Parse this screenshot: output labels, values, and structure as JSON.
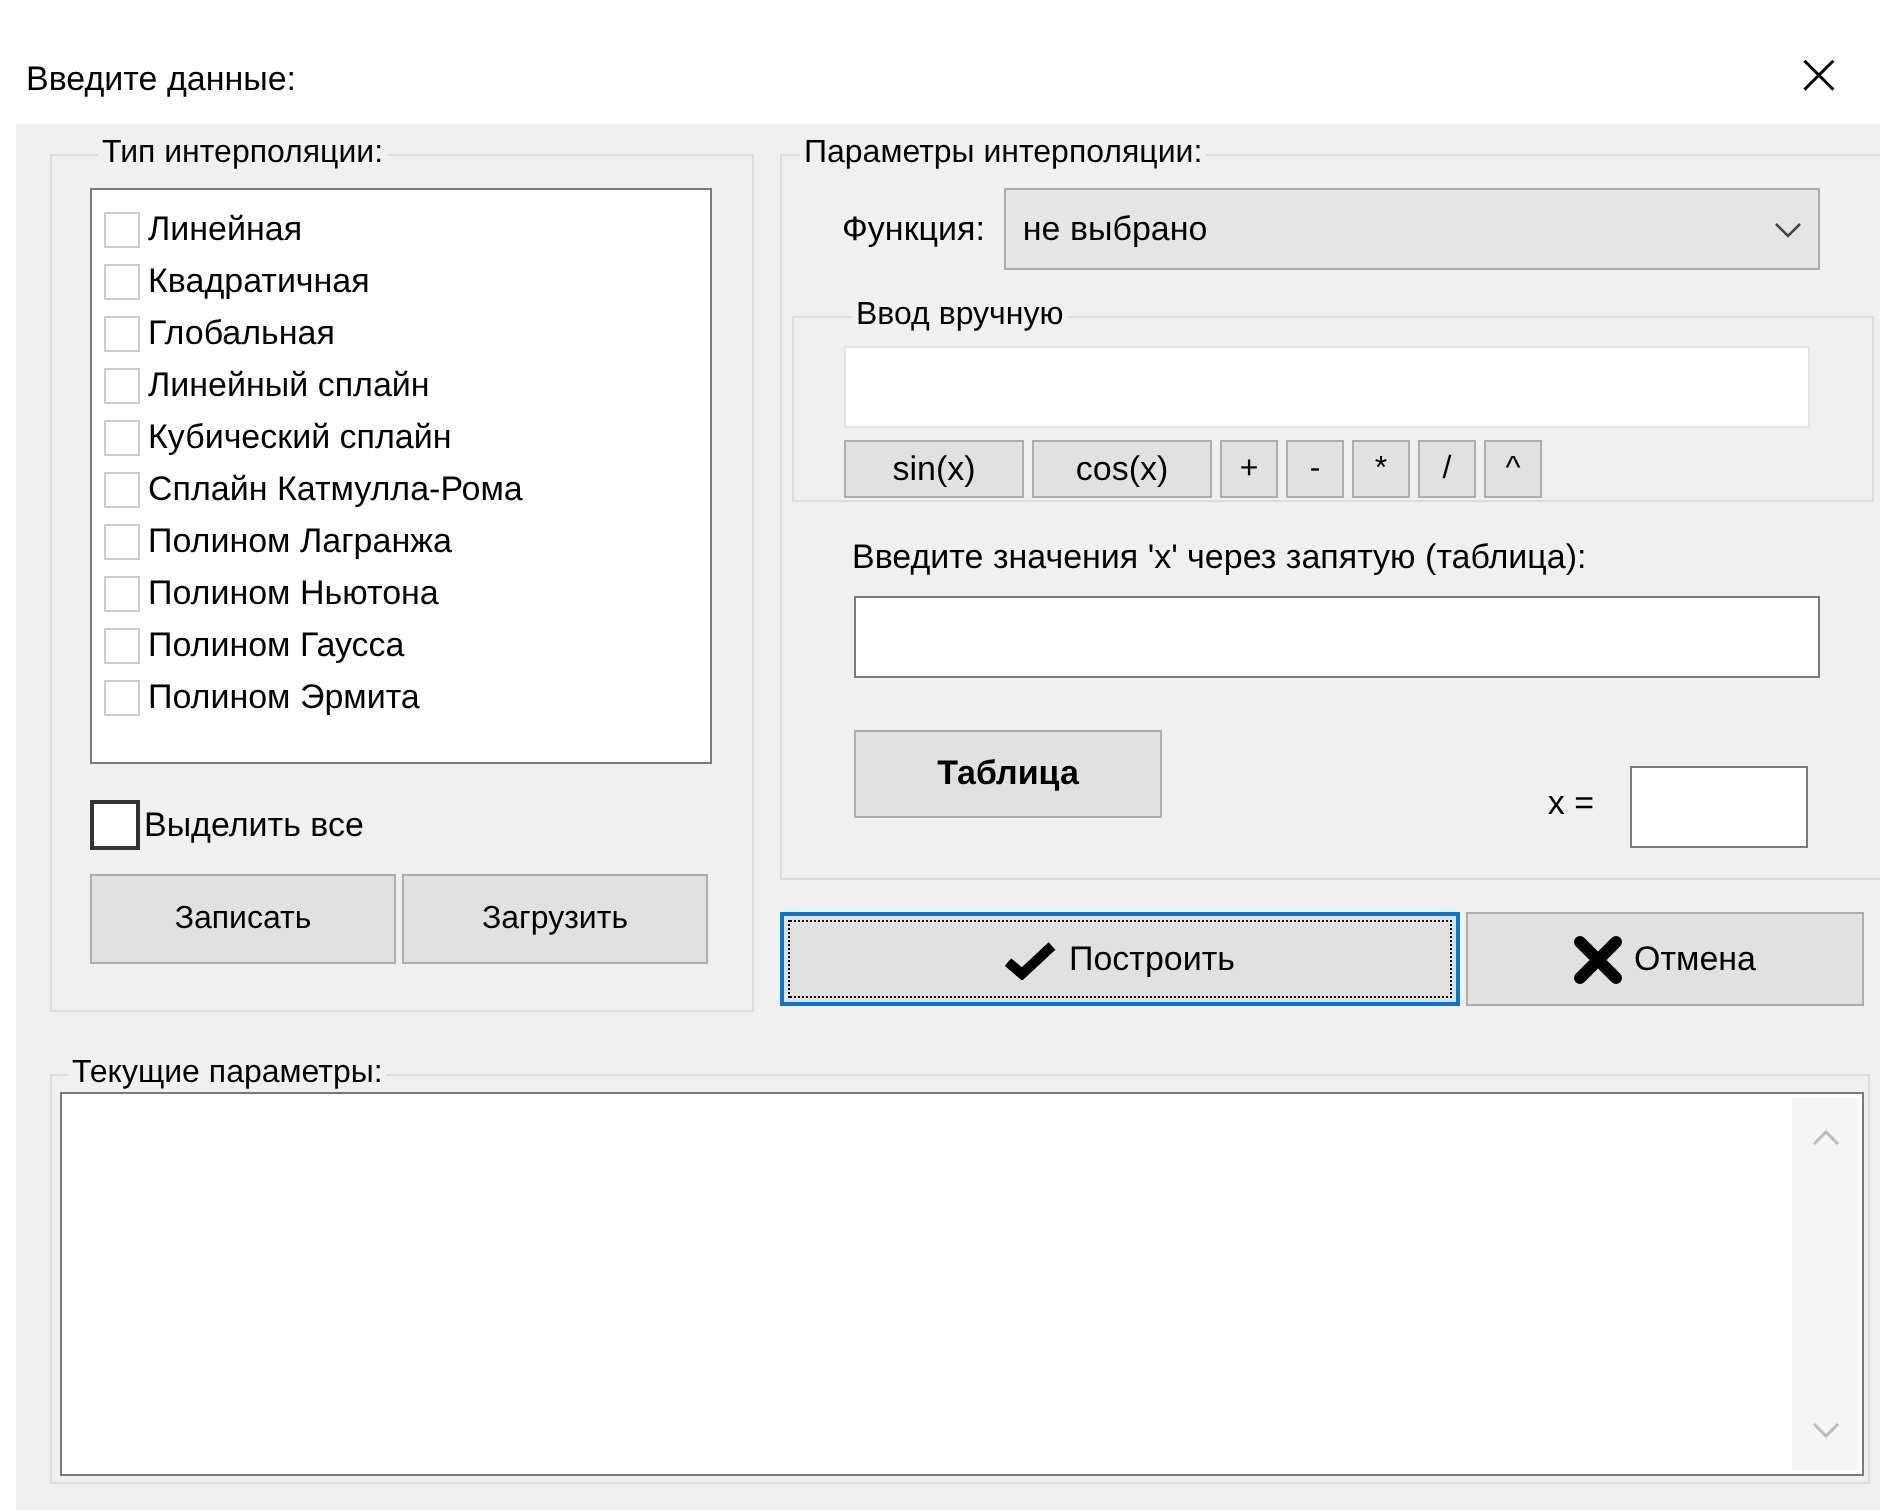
{
  "window": {
    "title": "Введите данные:",
    "close": "×"
  },
  "interpolation_type": {
    "title": "Тип интерполяции:",
    "items": [
      {
        "label": "Линейная",
        "checked": false
      },
      {
        "label": "Квадратичная",
        "checked": false
      },
      {
        "label": "Глобальная",
        "checked": false
      },
      {
        "label": "Линейный сплайн",
        "checked": false
      },
      {
        "label": "Кубический сплайн",
        "checked": false
      },
      {
        "label": "Сплайн Катмулла-Рома",
        "checked": false
      },
      {
        "label": "Полином Лагранжа",
        "checked": false
      },
      {
        "label": "Полином Ньютона",
        "checked": false
      },
      {
        "label": "Полином Гаусса",
        "checked": false
      },
      {
        "label": "Полином Эрмита",
        "checked": false
      }
    ],
    "select_all": {
      "label": "Выделить все",
      "checked": false
    },
    "buttons": [
      "Записать",
      "Загрузить"
    ]
  },
  "parameters": {
    "title": "Параметры интерполяции:",
    "function_label": "Функция:",
    "function_value": "не выбрано",
    "manual": {
      "title": "Ввод вручную",
      "keys": [
        "sin(x)",
        "cos(x)",
        "+",
        "-",
        "*",
        "/",
        "^"
      ]
    },
    "x_values_label": "Введите значения 'x' через запятую (таблица):",
    "table_button": "Таблица",
    "x_label": "x ="
  },
  "actions": [
    {
      "label": "Построить",
      "kind": "check",
      "focused": true
    },
    {
      "label": "Отмена",
      "kind": "cross",
      "focused": false
    }
  ],
  "current": {
    "title": "Текущие параметры:"
  }
}
